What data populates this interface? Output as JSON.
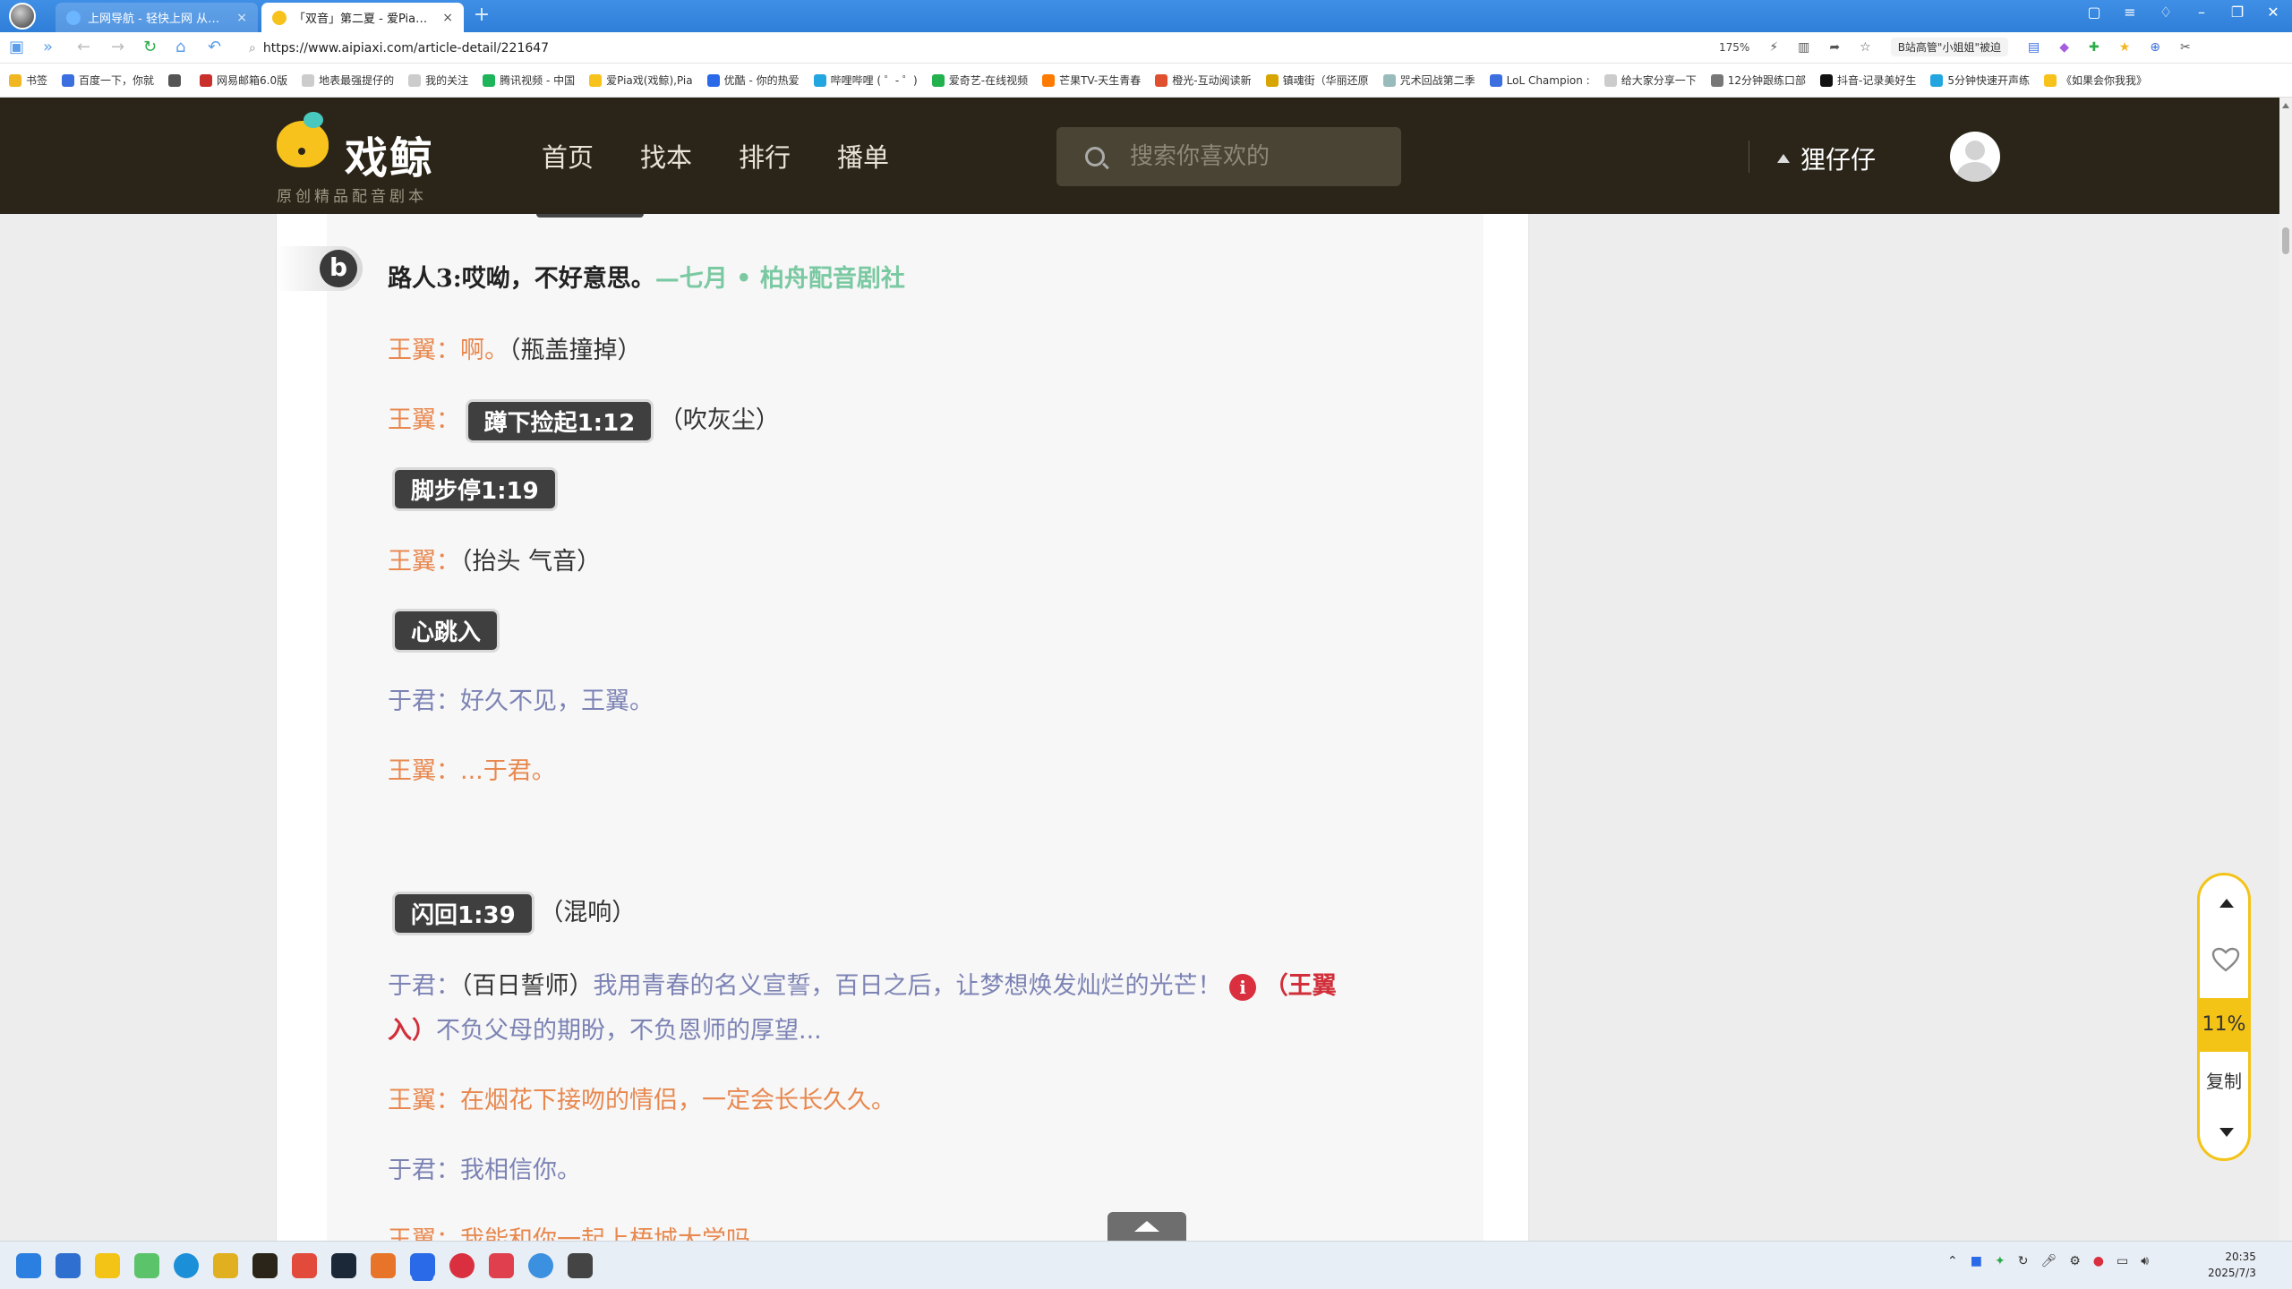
{
  "browser": {
    "tabs": [
      {
        "title": "上网导航 - 轻快上网 从这里开始",
        "fav": "#6bb6ff"
      },
      {
        "title": "「双音」第二夏 - 爱Pia戏网,家",
        "fav": "#2b2519"
      }
    ],
    "url": "https://www.aipiaxi.com/article-detail/221647",
    "zoom": "175%",
    "search_pill": "B站高管\"小姐姐\"被迫",
    "bookmarks": [
      {
        "label": "书签",
        "color": "#f1b722"
      },
      {
        "label": "百度一下，你就",
        "color": "#3b6fe0"
      },
      {
        "label": "",
        "color": "#555"
      },
      {
        "label": "网易邮箱6.0版",
        "color": "#c9302c"
      },
      {
        "label": "地表最强提仔的",
        "color": "#ccc"
      },
      {
        "label": "我的关注",
        "color": "#ccc"
      },
      {
        "label": "腾讯视频 - 中国",
        "color": "#1eb45a"
      },
      {
        "label": "爱Pia戏(戏鲸),Pia",
        "color": "#f7c21b"
      },
      {
        "label": "优酷 - 你的热爱",
        "color": "#2a6ae8"
      },
      {
        "label": "哔哩哔哩 ( ゜- ゜)",
        "color": "#23a6e0"
      },
      {
        "label": "爱奇艺-在线视频",
        "color": "#22b14c"
      },
      {
        "label": "芒果TV-天生青春",
        "color": "#ff7a00"
      },
      {
        "label": "橙光-互动阅读新",
        "color": "#e1502e"
      },
      {
        "label": "镇魂街（华丽还原",
        "color": "#d8a400"
      },
      {
        "label": "咒术回战第二季",
        "color": "#9bb"
      },
      {
        "label": "LoL Champion :",
        "color": "#3b6fe0"
      },
      {
        "label": "给大家分享一下",
        "color": "#ccc"
      },
      {
        "label": "12分钟跟练口部",
        "color": "#777"
      },
      {
        "label": "抖音-记录美好生",
        "color": "#111"
      },
      {
        "label": "5分钟快速开声练",
        "color": "#23a6e0"
      },
      {
        "label": "《如果会你我我》",
        "color": "#f7c21b"
      }
    ]
  },
  "site": {
    "logo_name": "戏鲸",
    "logo_slogan": "原创精品配音剧本",
    "nav": [
      "首页",
      "找本",
      "排行",
      "播单"
    ],
    "search_placeholder": "搜索你喜欢的",
    "username": "狸仔仔"
  },
  "script": {
    "top_line": {
      "speaker": "路人3:",
      "text": "哎呦，不好意思。",
      "tag": "—七月 • 柏舟配音剧社"
    },
    "l1": {
      "speaker": "王翼：",
      "text": "啊。",
      "stage": "（瓶盖撞掉）"
    },
    "l2": {
      "speaker": "王翼：",
      "cue": "蹲下捡起1:12",
      "stage": "（吹灰尘）"
    },
    "l3": {
      "cue": "脚步停1:19"
    },
    "l4": {
      "speaker": "王翼：",
      "stage": "（抬头 气音）"
    },
    "l5": {
      "cue": "心跳入"
    },
    "l6": {
      "speaker": "于君：",
      "text": "好久不见，王翼。"
    },
    "l7": {
      "speaker": "王翼：",
      "text": "...于君。"
    },
    "l8": {
      "cue": "闪回1:39",
      "stage": "（混响）"
    },
    "l9": {
      "speaker": "于君：",
      "stage": "（百日誓师）",
      "text": "我用青春的名义宣誓，百日之后，让梦想焕发灿烂的光芒！",
      "badge": "i",
      "note1": "（王翼",
      "note2": "入）",
      "text2": "不负父母的期盼，不负恩师的厚望..."
    },
    "l10": {
      "speaker": "王翼：",
      "text": "在烟花下接吻的情侣，一定会长长久久。"
    },
    "l11": {
      "speaker": "于君：",
      "text": "我相信你。"
    },
    "l12": {
      "speaker": "王翼：",
      "text": "我能和你一起上梧城大学吗"
    }
  },
  "float_tool": {
    "progress": "11%",
    "copy_label": "复制"
  },
  "clock": {
    "time": "20:35",
    "date": "2025/7/3"
  }
}
